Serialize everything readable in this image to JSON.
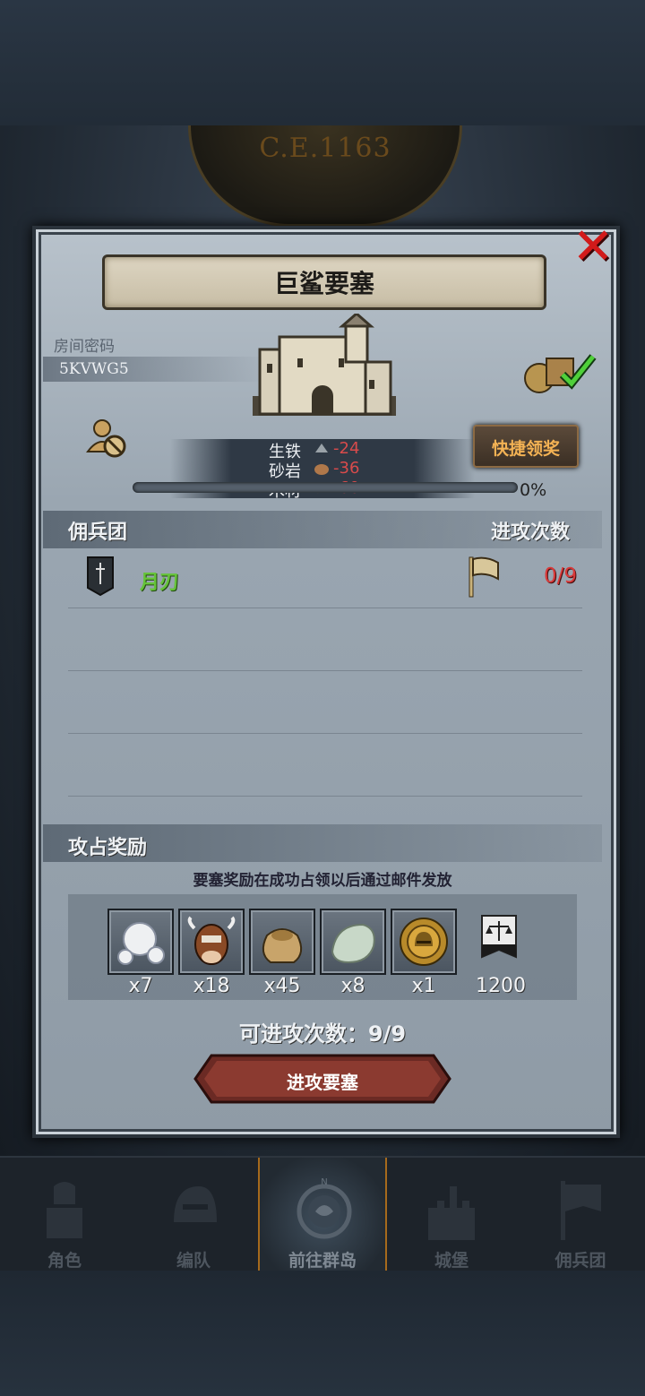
{
  "era": "C.E.1163",
  "fortress": {
    "title": "巨鲨要塞",
    "room_label": "房间密码",
    "room_code": "5KVWG5",
    "quick_claim_label": "快捷领奖",
    "resources": [
      {
        "name": "生铁",
        "value": "-24"
      },
      {
        "name": "砂岩",
        "value": "-36"
      },
      {
        "name": "木材",
        "value": "-60"
      }
    ],
    "progress_text": "0%",
    "progress_fraction": 0
  },
  "mercenary": {
    "section_title": "佣兵团",
    "attacks_title": "进攻次数",
    "rows": [
      {
        "name": "月刃",
        "attacks": "0/9"
      }
    ]
  },
  "rewards": {
    "section_title": "攻占奖励",
    "note": "要塞奖励在成功占领以后通过邮件发放",
    "items": [
      {
        "icon": "pearl-icon",
        "count": "x7"
      },
      {
        "icon": "cow-icon",
        "count": "x18"
      },
      {
        "icon": "grain-sack-icon",
        "count": "x45"
      },
      {
        "icon": "stone-icon",
        "count": "x8"
      },
      {
        "icon": "helmet-coin-icon",
        "count": "x1"
      },
      {
        "icon": "guild-banner-icon",
        "count": "1200"
      }
    ],
    "available_attacks": "可进攻次数：9/9",
    "attack_button": "进攻要塞"
  },
  "nav": {
    "items": [
      {
        "label": "角色",
        "icon": "knight-icon"
      },
      {
        "label": "编队",
        "icon": "helmet-icon"
      },
      {
        "label": "前往群岛",
        "icon": "compass-icon"
      },
      {
        "label": "城堡",
        "icon": "castle-icon"
      },
      {
        "label": "佣兵团",
        "icon": "banner-icon"
      }
    ]
  },
  "colors": {
    "accent_orange": "#f3b254",
    "merc_green": "#66c33a",
    "negative_red": "#d84b4b",
    "close_red": "#d21a1a"
  }
}
